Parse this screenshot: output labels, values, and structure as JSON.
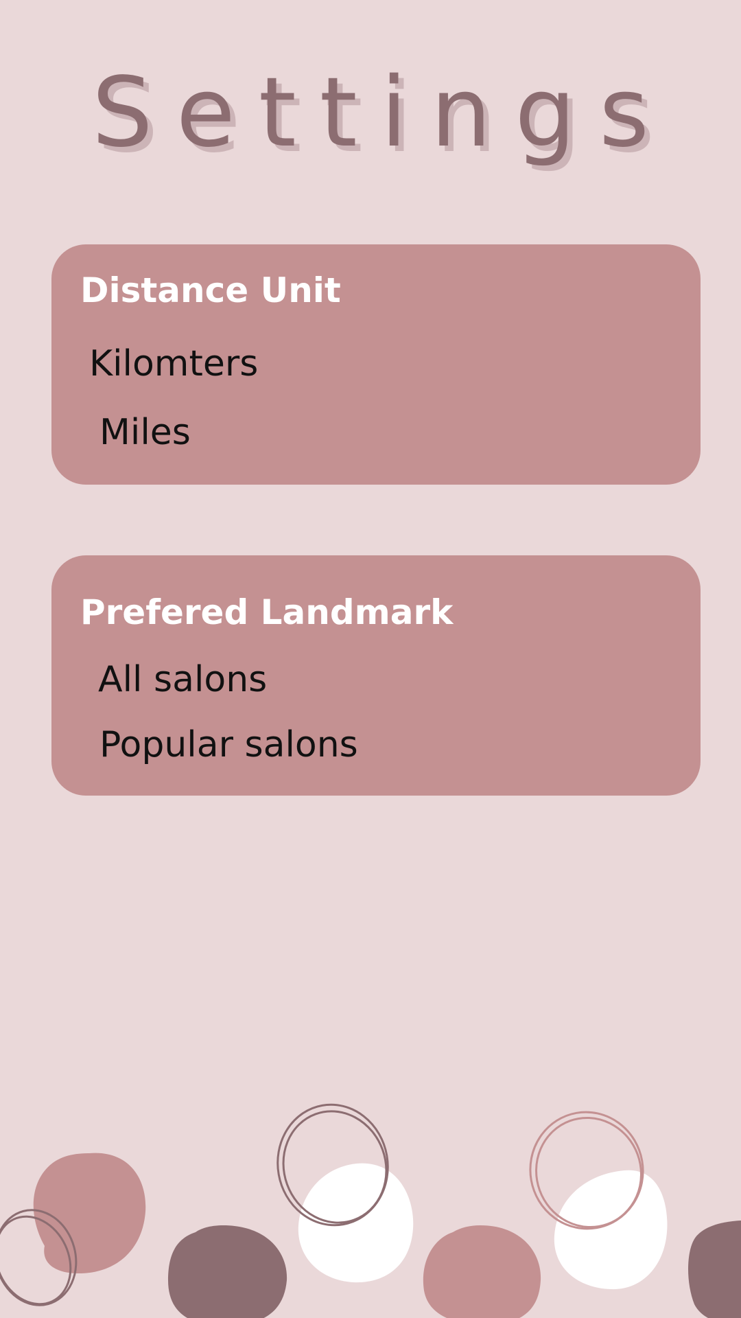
{
  "page": {
    "title": "Settings"
  },
  "colors": {
    "background": "#ead8d9",
    "card": "#c49192",
    "title": "#8c6d71",
    "blob_dark": "#8c6d71",
    "blob_pink": "#c49192",
    "blob_white": "#ffffff"
  },
  "distance_unit": {
    "heading": "Distance Unit",
    "options": [
      "Kilomters",
      "Miles"
    ]
  },
  "preferred_landmark": {
    "heading": "Prefered Landmark",
    "options": [
      "All salons",
      "Popular salons"
    ]
  }
}
